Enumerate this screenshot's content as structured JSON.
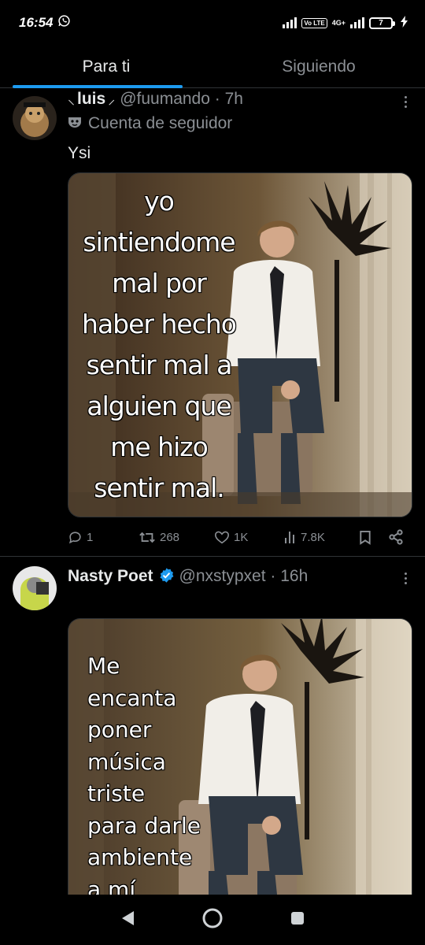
{
  "status_bar": {
    "time": "16:54",
    "network_label": "4G+",
    "volte_label": "Vo LTE",
    "battery_level": "7"
  },
  "tabs": [
    {
      "label": "Para ti",
      "active": true
    },
    {
      "label": "Siguiendo",
      "active": false
    }
  ],
  "tweets": [
    {
      "name": "luis",
      "handle": "@fuumando · 7h",
      "follow_context": "Cuenta de seguidor",
      "text": "Ysi",
      "meme_text": "yo sintiendome mal por haber hecho sentir mal a alguien que me hizo sentir mal.",
      "meme_lines": [
        "yo",
        "sintiendome",
        "mal por",
        "haber hecho",
        "sentir mal a",
        "alguien que",
        "me hizo",
        "sentir mal."
      ],
      "replies": "1",
      "retweets": "268",
      "likes": "1K",
      "views": "7.8K"
    },
    {
      "name": "Nasty Poet",
      "handle": "@nxstypxet · 16h",
      "verified": true,
      "meme_text": "Me encanta poner música triste para darle ambiente a mí",
      "meme_lines": [
        "Me",
        "encanta",
        "poner",
        "música",
        "triste",
        "para darle",
        "ambiente",
        "a mí"
      ]
    }
  ],
  "colors": {
    "accent": "#1d9bf0",
    "background": "#000000",
    "text_primary": "#e7e9ea",
    "text_secondary": "#8b8f94"
  },
  "icons": [
    "whatsapp-icon",
    "signal-icon",
    "battery-icon",
    "charging-icon",
    "more-icon",
    "mask-icon",
    "reply-icon",
    "retweet-icon",
    "like-icon",
    "views-icon",
    "bookmark-icon",
    "share-icon",
    "verified-icon",
    "back-icon",
    "home-icon",
    "recents-icon"
  ]
}
